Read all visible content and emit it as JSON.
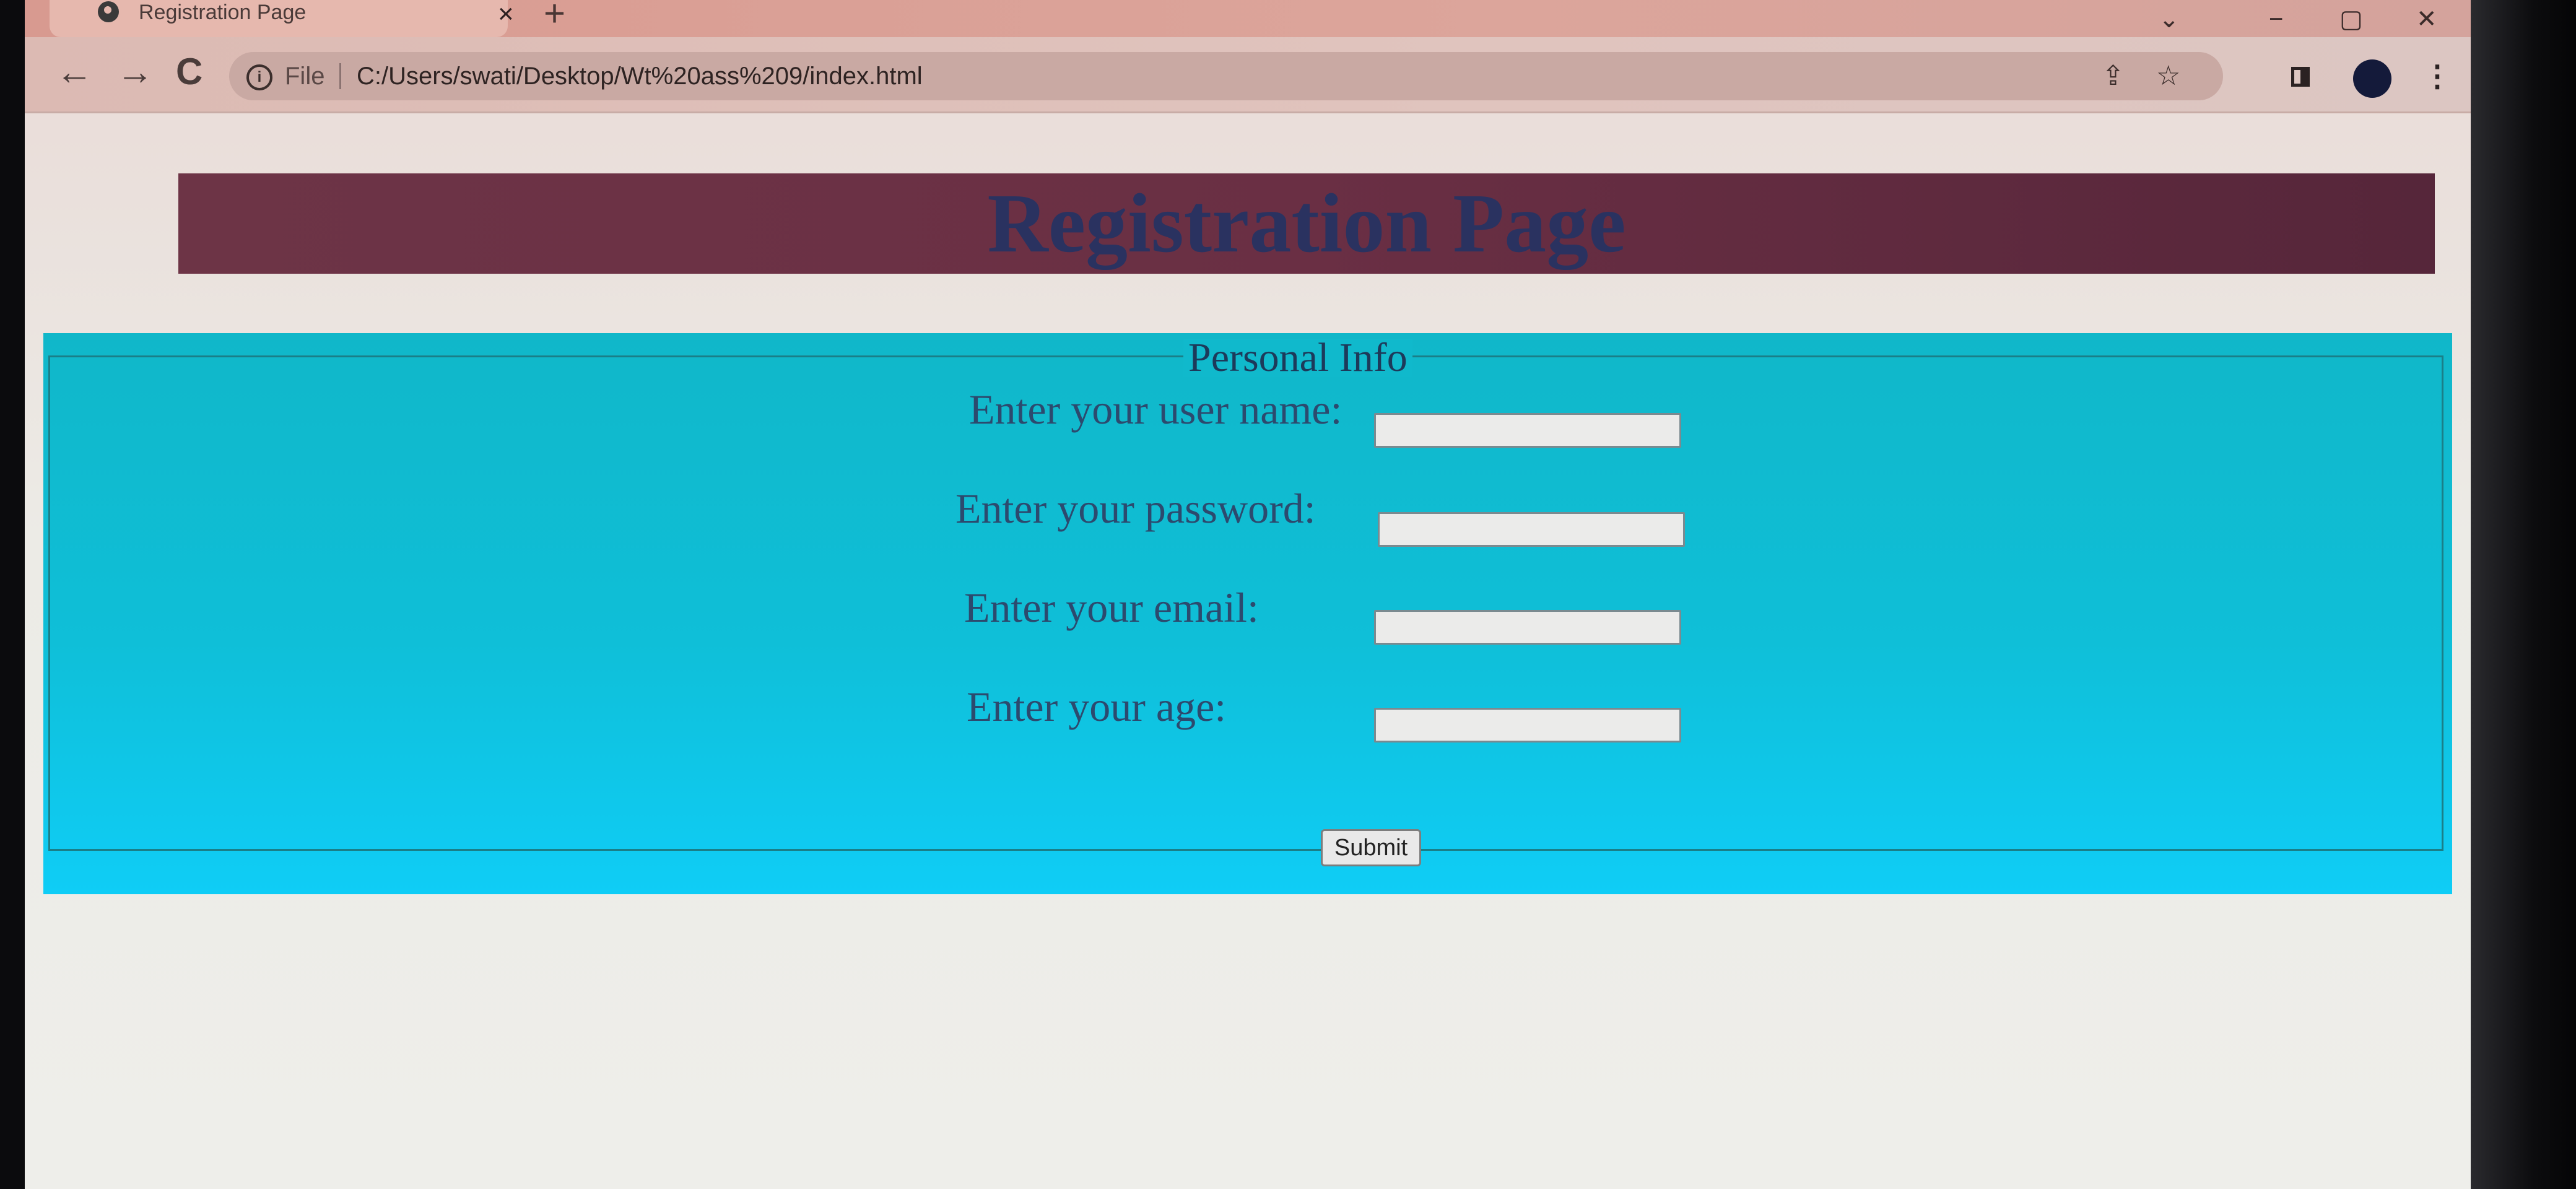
{
  "browser": {
    "tab": {
      "title": "Registration Page",
      "close_icon": "×",
      "new_tab_icon": "+"
    },
    "window_controls": {
      "tab_search_icon": "⌄",
      "minimize_icon": "−",
      "restore_icon": "▢",
      "close_icon": "✕"
    },
    "nav": {
      "back_icon": "←",
      "forward_icon": "→",
      "reload_icon": "C"
    },
    "omnibox": {
      "info_icon": "i",
      "scheme_label": "File",
      "url": "C:/Users/swati/Desktop/Wt%20ass%209/index.html",
      "share_icon": "⇪",
      "bookmark_icon": "☆"
    },
    "menu_icon": "⋮"
  },
  "page": {
    "title": "Registration Page",
    "colors": {
      "header_background": "#6a2f44",
      "title_text": "#2a3260",
      "form_background": "#0fcdf6"
    },
    "form": {
      "legend": "Personal Info",
      "fields": [
        {
          "label": "Enter your user name:",
          "value": ""
        },
        {
          "label": "Enter your password:",
          "value": ""
        },
        {
          "label": "Enter your email:",
          "value": ""
        },
        {
          "label": "Enter your age:",
          "value": ""
        }
      ],
      "submit_label": "Submit"
    }
  }
}
